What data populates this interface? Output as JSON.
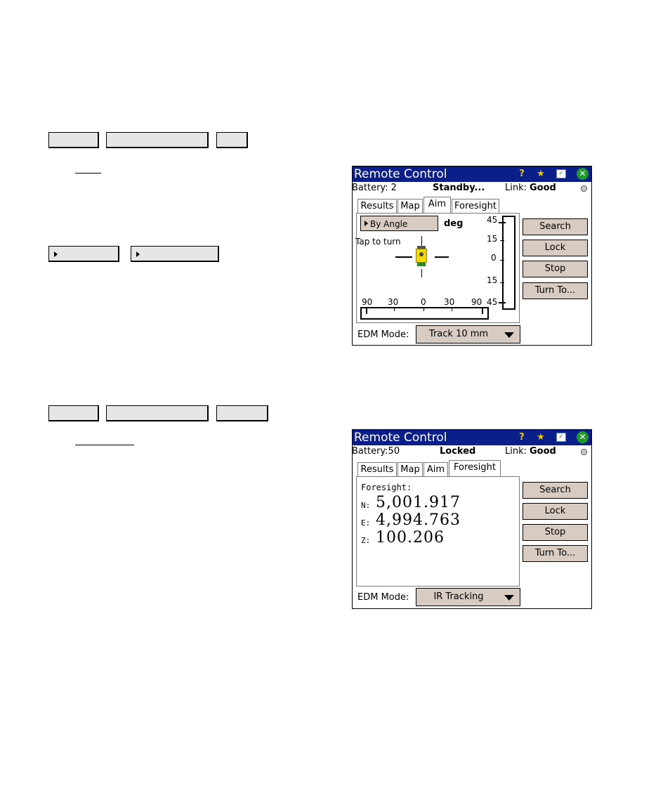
{
  "screen1": {
    "title": "Remote Control",
    "battery": "Battery: 2",
    "status": "Standby...",
    "link_label": "Link:",
    "link_value": "Good",
    "tabs": [
      "Results",
      "Map",
      "Aim",
      "Foresight"
    ],
    "active_tab": "Aim",
    "aim": {
      "mode_button": "By Angle",
      "unit": "deg",
      "tap_hint": "Tap to turn",
      "vertical_scale": [
        "45",
        "15",
        "0",
        "15",
        "45"
      ],
      "horizontal_scale": [
        "90",
        "30",
        "0",
        "30",
        "90"
      ]
    },
    "buttons": {
      "search": "Search",
      "lock": "Lock",
      "stop": "Stop",
      "turn_to": "Turn To..."
    },
    "edm_label": "EDM Mode:",
    "edm_value": "Track 10 mm"
  },
  "screen2": {
    "title": "Remote Control",
    "battery": "Battery:50",
    "status": "Locked",
    "link_label": "Link:",
    "link_value": "Good",
    "tabs": [
      "Results",
      "Map",
      "Aim",
      "Foresight"
    ],
    "active_tab": "Foresight",
    "foresight": {
      "heading": "Foresight:",
      "n_label": "N:",
      "n_value": "5,001.917",
      "e_label": "E:",
      "e_value": "4,994.763",
      "z_label": "Z:",
      "z_value": "100.206"
    },
    "buttons": {
      "search": "Search",
      "lock": "Lock",
      "stop": "Stop",
      "turn_to": "Turn To..."
    },
    "edm_label": "EDM Mode:",
    "edm_value": "IR Tracking"
  },
  "colors": {
    "titlebar": "#0b1f8a",
    "button_face": "#d8ccc2",
    "help_icon": "#e8c800",
    "close_icon": "#1e9a2c"
  }
}
